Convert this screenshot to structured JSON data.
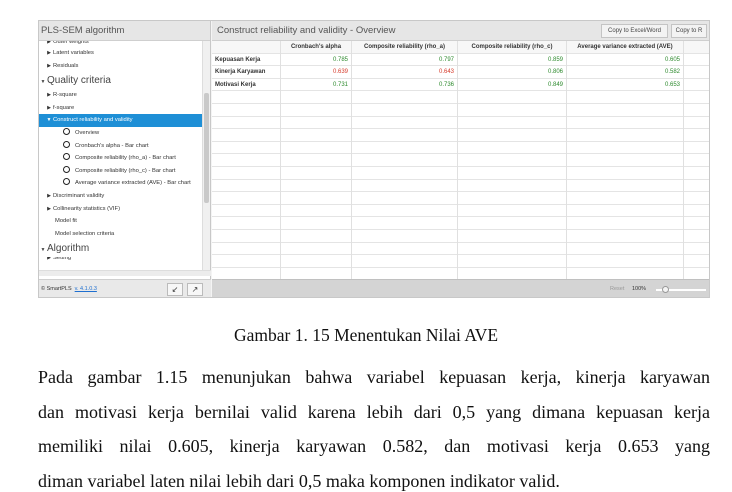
{
  "left_panel": {
    "title": "PLS-SEM algorithm",
    "tree": [
      {
        "label": "Outer weights",
        "level": "sub",
        "cut": true
      },
      {
        "label": "Latent variables",
        "level": "sub"
      },
      {
        "label": "Residuals",
        "level": "sub"
      },
      {
        "label": "Quality criteria",
        "level": "top"
      },
      {
        "label": "R-square",
        "level": "sub"
      },
      {
        "label": "f-square",
        "level": "sub"
      },
      {
        "label": "Construct reliability and validity",
        "level": "sub",
        "selected": true
      },
      {
        "label": "Overview",
        "level": "leaf"
      },
      {
        "label": "Cronbach's alpha - Bar chart",
        "level": "leaf"
      },
      {
        "label": "Composite reliability (rho_a) - Bar chart",
        "level": "leaf"
      },
      {
        "label": "Composite reliability (rho_c) - Bar chart",
        "level": "leaf"
      },
      {
        "label": "Average variance extracted (AVE) - Bar chart",
        "level": "leaf"
      },
      {
        "label": "Discriminant validity",
        "level": "sub"
      },
      {
        "label": "Collinearity statistics (VIF)",
        "level": "sub"
      },
      {
        "label": "Model fit",
        "level": "plain"
      },
      {
        "label": "Model selection criteria",
        "level": "plain"
      },
      {
        "label": "Algorithm",
        "level": "top"
      },
      {
        "label": "Setting",
        "level": "sub",
        "cut": true
      }
    ],
    "footer_brand": "© SmartPLS",
    "footer_version": "v. 4.1.0.3"
  },
  "right_panel": {
    "title": "Construct reliability and validity - Overview",
    "copy_excel": "Copy to Excel/Word",
    "copy_r": "Copy to R",
    "columns": [
      "Cronbach's alpha",
      "Composite reliability (rho_a)",
      "Composite reliability (rho_c)",
      "Average variance extracted (AVE)"
    ],
    "rows": [
      {
        "label": "Kepuasan Kerja",
        "values": [
          "0.785",
          "0.797",
          "0.859",
          "0.605"
        ],
        "red": [
          false,
          false,
          false,
          false
        ]
      },
      {
        "label": "Kinerja Karyawan",
        "values": [
          "0.639",
          "0.643",
          "0.806",
          "0.582"
        ],
        "red": [
          true,
          true,
          false,
          false
        ]
      },
      {
        "label": "Motivasi Kerja",
        "values": [
          "0.731",
          "0.736",
          "0.849",
          "0.653"
        ],
        "red": [
          false,
          false,
          false,
          false
        ]
      }
    ],
    "reset": "Reset",
    "zoom": "100%"
  },
  "caption": "Gambar 1.  15 Menentukan Nilai AVE",
  "paragraph_lines": [
    "Pada gambar 1.15 menunjukan bahwa variabel kepuasan kerja, kinerja karyawan",
    "dan motivasi kerja bernilai valid karena lebih dari 0,5 yang dimana kepuasan kerja",
    "memiliki nilai 0.605, kinerja karyawan 0.582, dan motivasi kerja 0.653 yang",
    "diman variabel laten nilai lebih dari 0,5 maka komponen indikator valid."
  ],
  "colors": {
    "selected": "#1e8fd6",
    "green": "#2d8a2d",
    "red": "#d63a2a"
  }
}
